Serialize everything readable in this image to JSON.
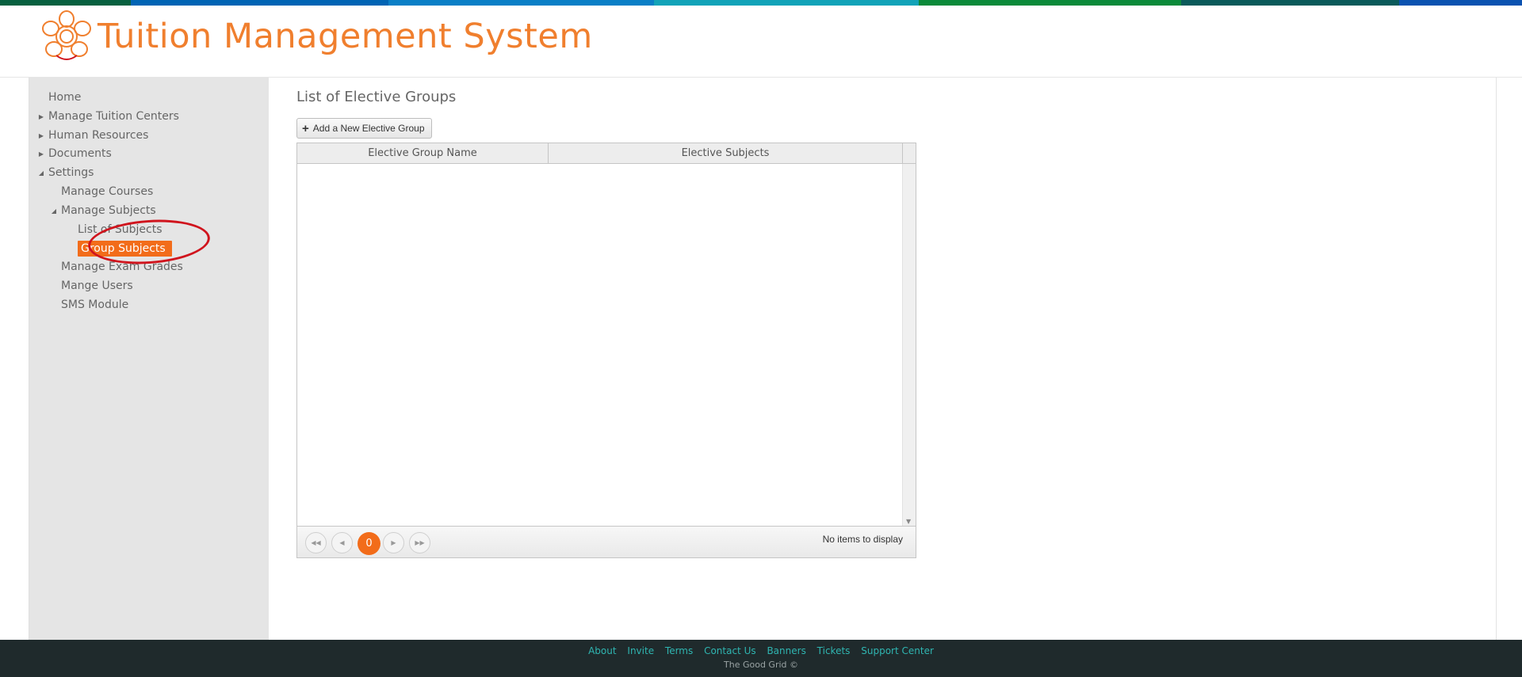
{
  "brand": {
    "title": "Tuition Management System",
    "accent_color": "#f07f2e",
    "top_bar_colors": [
      "#08603f",
      "#0064b4",
      "#0a7fc6",
      "#12a3b8",
      "#0b8a3a",
      "#0a5a5a",
      "#0a52b0"
    ]
  },
  "sidebar": {
    "items": [
      {
        "label": "Home"
      },
      {
        "label": "Manage Tuition Centers"
      },
      {
        "label": "Human Resources"
      },
      {
        "label": "Documents"
      },
      {
        "label": "Settings"
      },
      {
        "label": "Manage Courses"
      },
      {
        "label": "Manage Subjects"
      },
      {
        "label": "List of Subjects"
      },
      {
        "label": "Group Subjects"
      },
      {
        "label": "Manage Exam Grades"
      },
      {
        "label": "Mange Users"
      },
      {
        "label": "SMS Module"
      }
    ],
    "active_color": "#f26c1a",
    "annotation_color": "#d0141d"
  },
  "main": {
    "page_title": "List of Elective Groups",
    "add_button_label": "Add a New Elective Group",
    "grid": {
      "columns": [
        "Elective Group Name",
        "Elective Subjects"
      ],
      "rows": [],
      "current_page": "0",
      "pager_info": "No items to display"
    }
  },
  "footer": {
    "links": [
      "About",
      "Invite",
      "Terms",
      "Contact Us",
      "Banners",
      "Tickets",
      "Support Center"
    ],
    "copyright": "The Good Grid ©"
  }
}
